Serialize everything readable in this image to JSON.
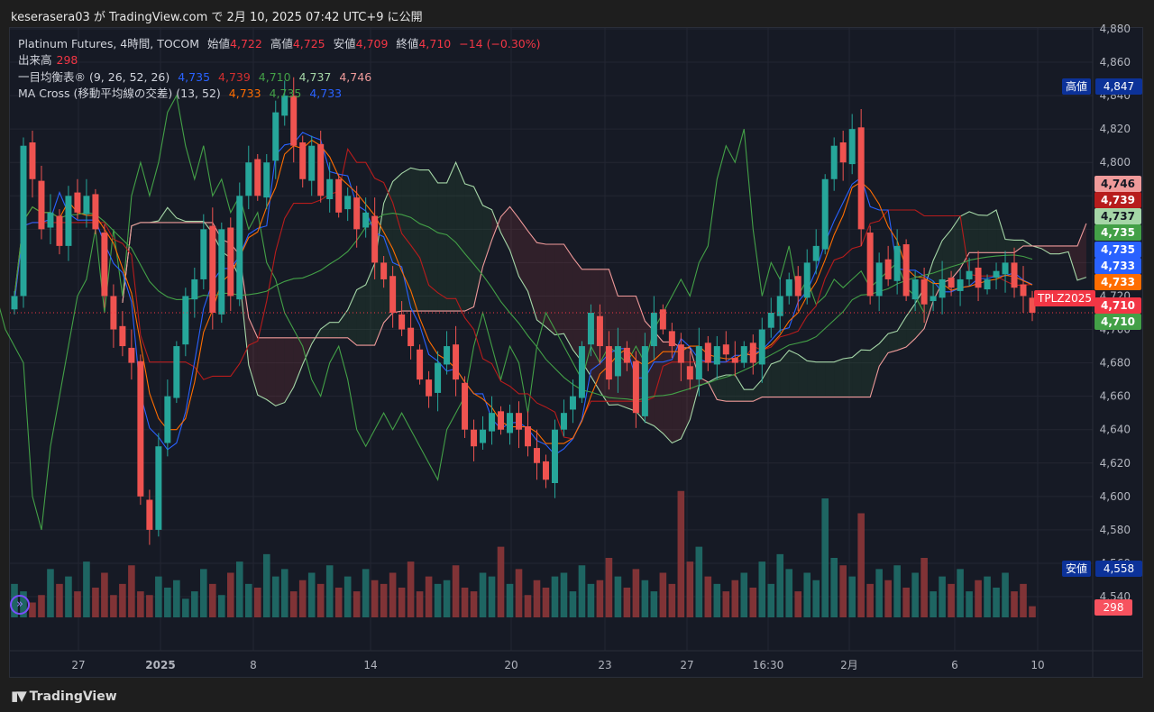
{
  "header": {
    "published": "keserasera03 が TradingView.com で 2月 10, 2025 07:42 UTC+9 に公開"
  },
  "legend": {
    "symbol": "Platinum Futures, 4時間, TOCOM",
    "open_label": "始値",
    "open": "4,722",
    "high_label": "高値",
    "high": "4,725",
    "low_label": "安値",
    "low": "4,709",
    "close_label": "終値",
    "close": "4,710",
    "change": "−14 (−0.30%)",
    "volume_label": "出来高",
    "volume": "298",
    "ichimoku_label": "一目均衡表® (9, 26, 52, 26)",
    "ichimoku_values": [
      "4,735",
      "4,739",
      "4,710",
      "4,737",
      "4,746"
    ],
    "ma_label": "MA Cross (移動平均線の交差) (13, 52)",
    "ma_values": [
      "4,733",
      "4,735",
      "4,733"
    ]
  },
  "colors": {
    "up": "#26a69a",
    "down": "#ef5350",
    "conversion": "#2962ff",
    "base": "#b71c1c",
    "lagging": "#43a047",
    "spanA": "#a5d6a7",
    "spanB": "#ef9a9a",
    "ma_fast": "#ff6d00",
    "ma_slow": "#43a047",
    "background": "#161a25"
  },
  "price_axis": {
    "ticks": [
      "4,880",
      "4,860",
      "4,840",
      "4,820",
      "4,800",
      "4,780",
      "4,760",
      "4,740",
      "4,720",
      "4,700",
      "4,680",
      "4,660",
      "4,640",
      "4,620",
      "4,600",
      "4,580",
      "4,560",
      "4,540"
    ],
    "labels": [
      {
        "value": "4,746",
        "color": "#ef9a9a",
        "text_color": "#131722"
      },
      {
        "value": "4,739",
        "color": "#b71c1c",
        "text_color": "#ffffff"
      },
      {
        "value": "4,737",
        "color": "#a5d6a7",
        "text_color": "#131722"
      },
      {
        "value": "4,735",
        "color": "#43a047",
        "text_color": "#ffffff"
      },
      {
        "value": "4,735",
        "color": "#2962ff",
        "text_color": "#ffffff"
      },
      {
        "value": "4,733",
        "color": "#2962ff",
        "text_color": "#ffffff"
      },
      {
        "value": "4,733",
        "color": "#ff6d00",
        "text_color": "#ffffff"
      },
      {
        "value": "4,710",
        "color": "#f23645",
        "text_color": "#ffffff"
      },
      {
        "value": "4,710",
        "color": "#43a047",
        "text_color": "#ffffff"
      }
    ],
    "high_marker": {
      "label": "高値",
      "value": "4,847"
    },
    "low_marker": {
      "label": "安値",
      "value": "4,558"
    },
    "symbol_tag": "TPLZ2025",
    "volume_tag": "298"
  },
  "time_axis": [
    "27",
    "2025",
    "8",
    "14",
    "20",
    "23",
    "27",
    "16:30",
    "2月",
    "6",
    "10"
  ],
  "chart_data": {
    "type": "candlestick",
    "ylim": [
      4540,
      4880
    ],
    "closes": [
      4720,
      4810,
      4790,
      4760,
      4770,
      4750,
      4780,
      4770,
      4780,
      4760,
      4720,
      4700,
      4690,
      4680,
      4600,
      4580,
      4630,
      4660,
      4690,
      4720,
      4730,
      4760,
      4710,
      4760,
      4720,
      4780,
      4800,
      4780,
      4800,
      4830,
      4840,
      4810,
      4790,
      4810,
      4780,
      4790,
      4770,
      4780,
      4760,
      4770,
      4740,
      4730,
      4710,
      4700,
      4690,
      4670,
      4660,
      4680,
      4690,
      4670,
      4640,
      4630,
      4640,
      4650,
      4640,
      4650,
      4640,
      4630,
      4620,
      4610,
      4640,
      4650,
      4660,
      4690,
      4710,
      4690,
      4670,
      4690,
      4680,
      4650,
      4690,
      4710,
      4700,
      4690,
      4680,
      4670,
      4690,
      4680,
      4690,
      4685,
      4680,
      4690,
      4680,
      4700,
      4710,
      4720,
      4730,
      4720,
      4740,
      4750,
      4790,
      4810,
      4800,
      4820,
      4760,
      4720,
      4740,
      4730,
      4750,
      4720,
      4730,
      4715,
      4720,
      4730,
      4725,
      4730,
      4735,
      4725,
      4730,
      4735,
      4740,
      4725,
      4720,
      4710
    ],
    "volumes": [
      900,
      700,
      400,
      600,
      1300,
      900,
      1100,
      700,
      1500,
      800,
      1200,
      600,
      900,
      1400,
      700,
      600,
      1100,
      800,
      1000,
      500,
      700,
      1300,
      900,
      600,
      1200,
      1500,
      900,
      800,
      1700,
      1100,
      1300,
      700,
      1000,
      1200,
      900,
      1400,
      800,
      1100,
      700,
      1300,
      1000,
      900,
      1200,
      800,
      1500,
      700,
      1100,
      900,
      1000,
      1400,
      800,
      700,
      1200,
      1100,
      1900,
      900,
      1300,
      600,
      1000,
      800,
      1100,
      1200,
      700,
      1400,
      900,
      1000,
      1600,
      1100,
      800,
      1300,
      1000,
      700,
      1200,
      900,
      3400,
      1500,
      1900,
      1100,
      900,
      700,
      1000,
      1200,
      800,
      1500,
      900,
      1700,
      1300,
      700,
      1200,
      1000,
      3200,
      1600,
      1400,
      1100,
      2800,
      900,
      1300,
      1000,
      1400,
      800,
      1200,
      1600,
      700,
      1100,
      900,
      1300,
      700,
      1000,
      1100,
      800,
      1200,
      700,
      900,
      300
    ]
  }
}
